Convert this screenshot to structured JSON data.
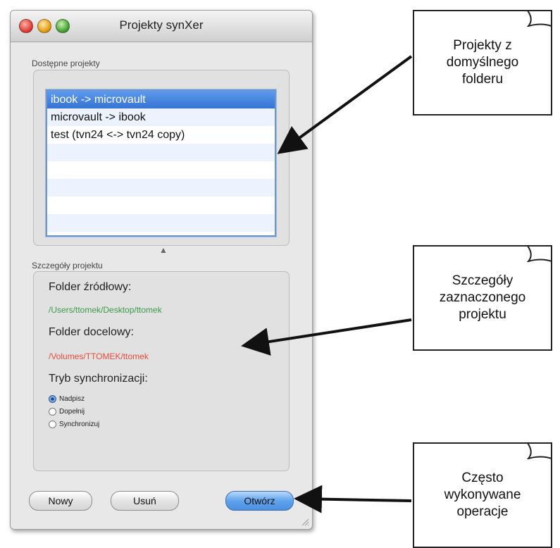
{
  "window": {
    "title": "Projekty synXer"
  },
  "projects": {
    "group_label": "Dostępne projekty",
    "items": [
      {
        "label": "ibook -> microvault",
        "selected": true
      },
      {
        "label": "microvault -> ibook",
        "selected": false
      },
      {
        "label": "test (tvn24 <-> tvn24 copy)",
        "selected": false
      }
    ]
  },
  "details": {
    "group_label": "Szczegóły projektu",
    "source_label": "Folder źródłowy:",
    "source_path": "/Users/ttomek/Desktop/ttomek",
    "source_color": "#3c9a4a",
    "target_label": "Folder docelowy:",
    "target_path": "/Volumes/TTOMEK/ttomek",
    "target_color": "#e84b3c",
    "mode_label": "Tryb synchronizacji:",
    "modes": [
      {
        "label": "Nadpisz",
        "selected": true
      },
      {
        "label": "Dopełnij",
        "selected": false
      },
      {
        "label": "Synchronizuj",
        "selected": false
      }
    ]
  },
  "buttons": {
    "new": "Nowy",
    "delete": "Usuń",
    "open": "Otwórz"
  },
  "callouts": {
    "projects": [
      "Projekty z",
      "domyślnego",
      "folderu"
    ],
    "details": [
      "Szczegóły",
      "zaznaczonego",
      "projektu"
    ],
    "operations": [
      "Często",
      "wykonywane",
      "operacje"
    ]
  }
}
